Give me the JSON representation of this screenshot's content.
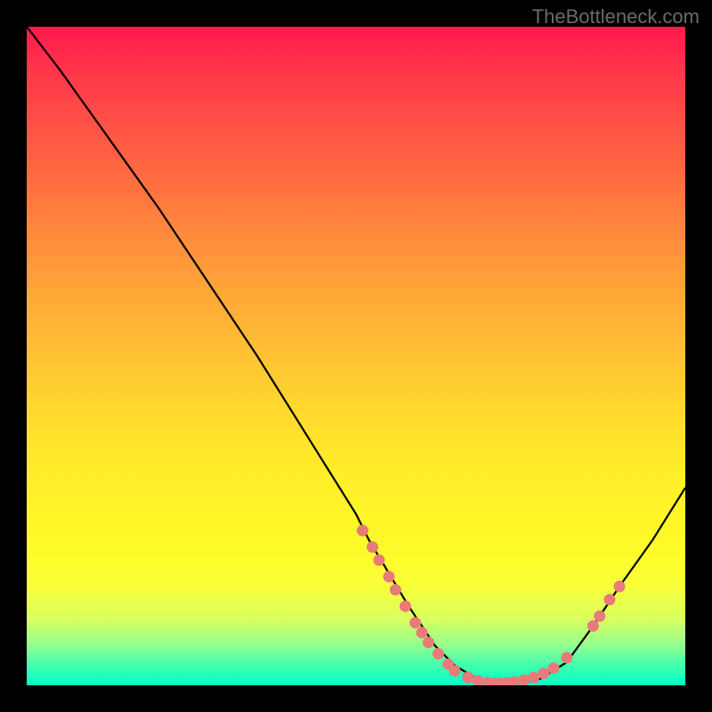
{
  "watermark": "TheBottleneck.com",
  "chart_data": {
    "type": "line",
    "title": "",
    "xlabel": "",
    "ylabel": "",
    "xlim": [
      0,
      100
    ],
    "ylim": [
      0,
      100
    ],
    "series": [
      {
        "name": "curve",
        "x": [
          0,
          5,
          10,
          15,
          20,
          25,
          30,
          35,
          40,
          45,
          50,
          52,
          55,
          58,
          62,
          65,
          68,
          70,
          72,
          75,
          78,
          82,
          86,
          90,
          95,
          100
        ],
        "y": [
          100,
          93.5,
          86.5,
          79.5,
          72.5,
          65,
          57.5,
          50,
          42,
          34,
          26,
          22,
          17,
          12,
          6,
          3,
          1.2,
          0.4,
          0.2,
          0.3,
          1.0,
          3.5,
          9,
          15,
          22,
          30
        ]
      }
    ],
    "annotations": {
      "dots": [
        {
          "x": 51,
          "y": 23.5
        },
        {
          "x": 52.5,
          "y": 21
        },
        {
          "x": 53.5,
          "y": 19
        },
        {
          "x": 55,
          "y": 16.5
        },
        {
          "x": 56,
          "y": 14.5
        },
        {
          "x": 57.5,
          "y": 12
        },
        {
          "x": 59,
          "y": 9.5
        },
        {
          "x": 60,
          "y": 8
        },
        {
          "x": 61,
          "y": 6.5
        },
        {
          "x": 62.5,
          "y": 4.8
        },
        {
          "x": 64,
          "y": 3.2
        },
        {
          "x": 65,
          "y": 2.2
        },
        {
          "x": 67,
          "y": 1.2
        },
        {
          "x": 68.5,
          "y": 0.7
        },
        {
          "x": 70,
          "y": 0.4
        },
        {
          "x": 71,
          "y": 0.3
        },
        {
          "x": 72,
          "y": 0.3
        },
        {
          "x": 73,
          "y": 0.4
        },
        {
          "x": 74,
          "y": 0.5
        },
        {
          "x": 75.5,
          "y": 0.8
        },
        {
          "x": 77,
          "y": 1.2
        },
        {
          "x": 78.5,
          "y": 1.8
        },
        {
          "x": 80,
          "y": 2.6
        },
        {
          "x": 82,
          "y": 4.2
        },
        {
          "x": 86,
          "y": 9.0
        },
        {
          "x": 87,
          "y": 10.5
        },
        {
          "x": 88.5,
          "y": 13.0
        },
        {
          "x": 90,
          "y": 15.0
        }
      ]
    }
  }
}
